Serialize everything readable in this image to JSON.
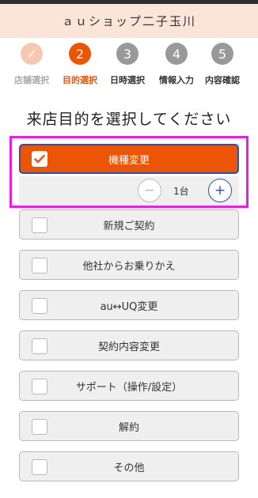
{
  "header": {
    "title": "ａｕショップ二子玉川"
  },
  "steps": [
    {
      "number": "✓",
      "label": "店舗選択",
      "state": "done"
    },
    {
      "number": "2",
      "label": "目的選択",
      "state": "active"
    },
    {
      "number": "3",
      "label": "日時選択",
      "state": "todo"
    },
    {
      "number": "4",
      "label": "情報入力",
      "state": "todo"
    },
    {
      "number": "5",
      "label": "内容確認",
      "state": "todo"
    }
  ],
  "main": {
    "heading": "来店目的を選択してください",
    "selected_option": {
      "label": "機種変更",
      "checked": true,
      "quantity": {
        "minus": "−",
        "value": "1台",
        "plus": "+"
      }
    },
    "options": [
      {
        "label": "新規ご契約",
        "checked": false
      },
      {
        "label": "他社からお乗りかえ",
        "checked": false
      },
      {
        "label": "au↔UQ変更",
        "checked": false
      },
      {
        "label": "契約内容変更",
        "checked": false
      },
      {
        "label": "サポート（操作/設定）",
        "checked": false
      },
      {
        "label": "解約",
        "checked": false
      },
      {
        "label": "その他",
        "checked": false
      }
    ]
  },
  "colors": {
    "accent": "#eb5505",
    "highlight": "#e61ee6",
    "header_bg": "#fbe4d8",
    "focus": "#2b4fb5"
  }
}
